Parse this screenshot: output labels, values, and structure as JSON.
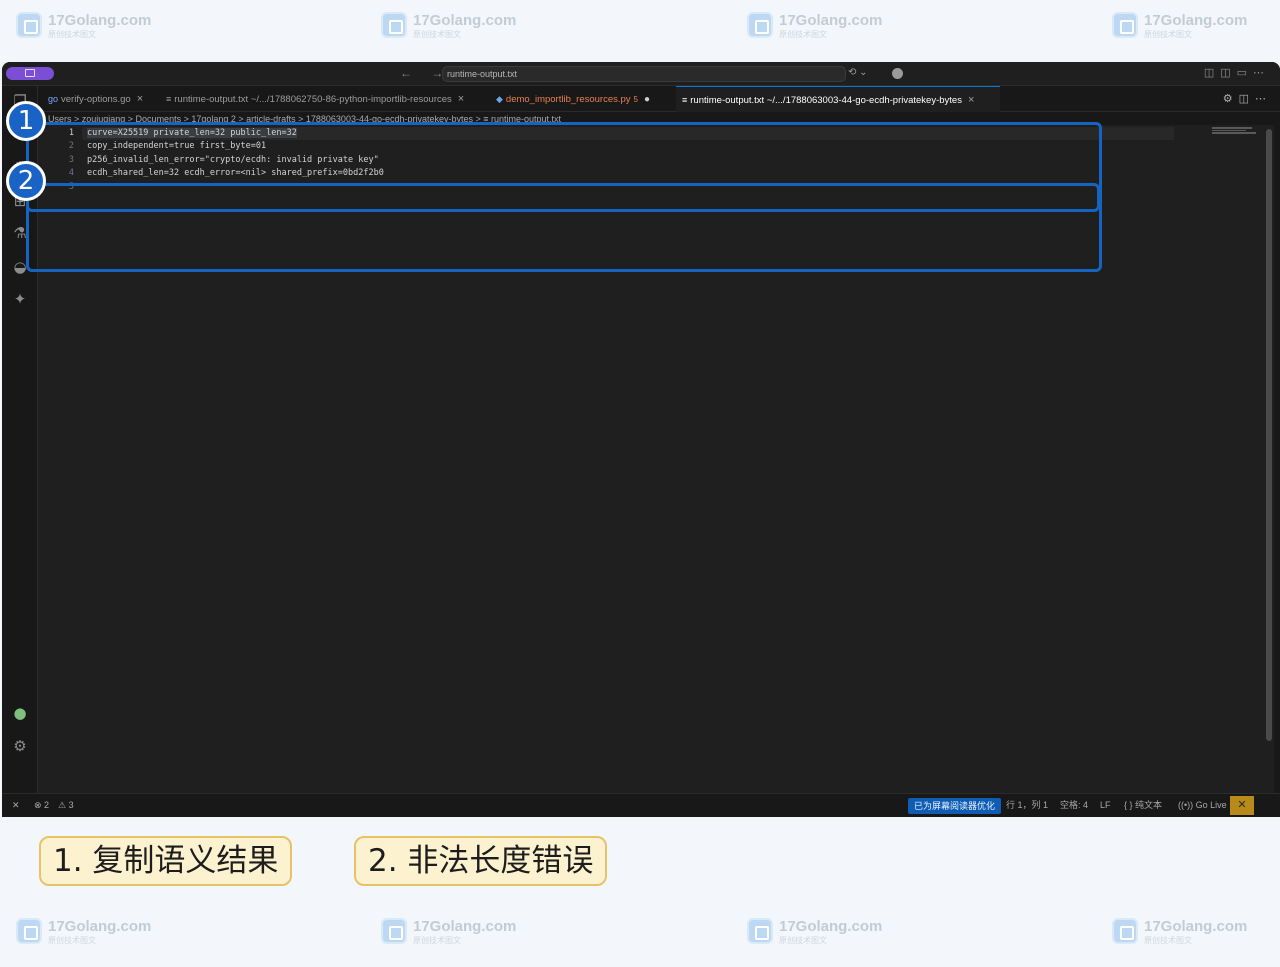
{
  "watermark": {
    "brand": "17Golang.com",
    "sub": "原创技术图文"
  },
  "titlebar": {
    "nav_arrows": "← →",
    "command_center": "runtime-output.txt"
  },
  "tabs": [
    {
      "icon": "go",
      "label": "verify-options.go",
      "close": "×"
    },
    {
      "icon": "≡",
      "label": "runtime-output.txt ~/.../1788062750-86-python-importlib-resources",
      "close": "×"
    },
    {
      "icon": "◆",
      "label": "demo_importlib_resources.py",
      "count": "5",
      "modified": "●"
    },
    {
      "icon": "≡",
      "label": "runtime-output.txt ~/.../1788063003-44-go-ecdh-privatekey-bytes",
      "close": "×"
    }
  ],
  "breadcrumb": "Users > zoujuqiang > Documents > 17golang 2 > article-drafts > 1788063003-44-go-ecdh-privatekey-bytes > ≡ runtime-output.txt",
  "editor": {
    "line_numbers": [
      "1",
      "2",
      "3",
      "4",
      "5"
    ],
    "lines": [
      "curve=X25519 private_len=32 public_len=32",
      "copy_independent=true first_byte=01",
      "p256_invalid_len_error=\"crypto/ecdh: invalid private key\"",
      "ecdh_shared_len=32 ecdh_error=<nil> shared_prefix=0bd2f2b0",
      ""
    ]
  },
  "statusbar": {
    "errors": "⊗ 2",
    "warnings": "⚠ 3",
    "accessibility": "已为屏幕阅读器优化",
    "position": "行 1，列 1",
    "spaces": "空格: 4",
    "eol": "LF",
    "language": "{ } 纯文本",
    "golive": "((•)) Go Live"
  },
  "annotations": {
    "markers": [
      "1",
      "2"
    ],
    "legend": [
      "1. 复制语义结果",
      "2. 非法长度错误"
    ]
  },
  "colors": {
    "highlight": "#1565c0",
    "legend_bg": "#fdf2cf",
    "legend_border": "#e6c368",
    "editor_bg": "#1f1f1f",
    "accent": "#0078d4"
  }
}
